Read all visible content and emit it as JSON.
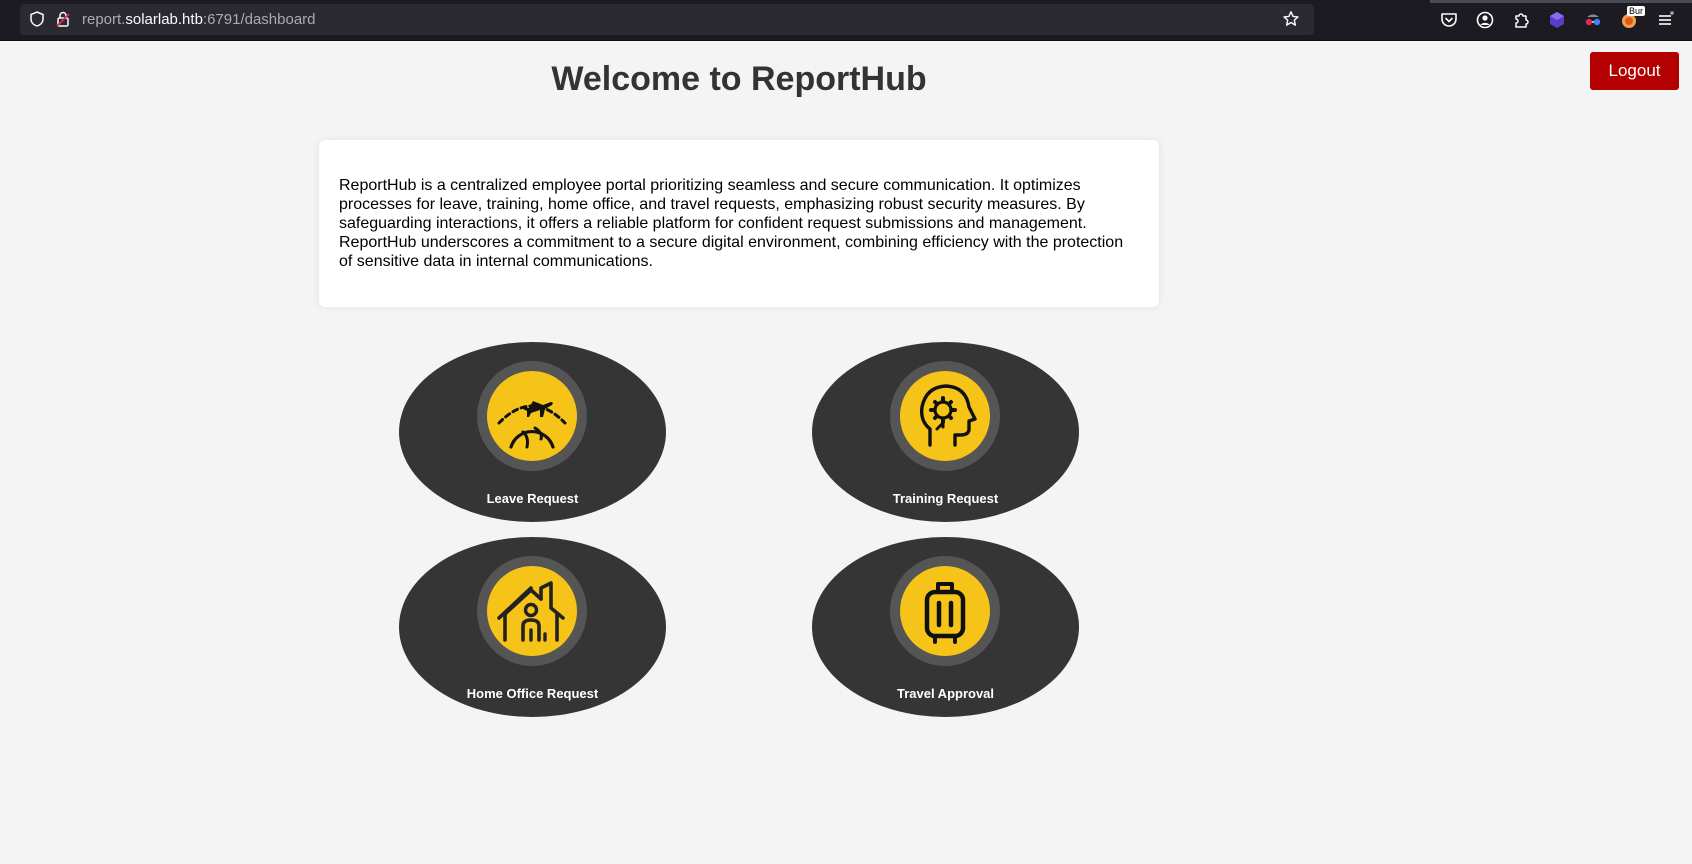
{
  "browser": {
    "url_prefix": "report.",
    "url_host": "solarlab.htb",
    "url_suffix": ":6791/dashboard",
    "extension_badge": "Bur"
  },
  "header": {
    "title": "Welcome to ReportHub",
    "logout_label": "Logout"
  },
  "intro": {
    "text": "ReportHub is a centralized employee portal prioritizing seamless and secure communication. It optimizes processes for leave, training, home office, and travel requests, emphasizing robust security measures. By safeguarding interactions, it offers a reliable platform for confident request submissions and management. ReportHub underscores a commitment to a secure digital environment, combining efficiency with the protection of sensitive data in internal communications."
  },
  "tiles": [
    {
      "label": "Leave Request",
      "icon": "plane-globe-icon"
    },
    {
      "label": "Training Request",
      "icon": "head-gear-icon"
    },
    {
      "label": "Home Office Request",
      "icon": "home-person-icon"
    },
    {
      "label": "Travel Approval",
      "icon": "suitcase-icon"
    }
  ],
  "colors": {
    "accent": "#f6c419",
    "tile_bg": "#353535",
    "logout_bg": "#b30000",
    "page_bg": "#f4f4f4"
  }
}
